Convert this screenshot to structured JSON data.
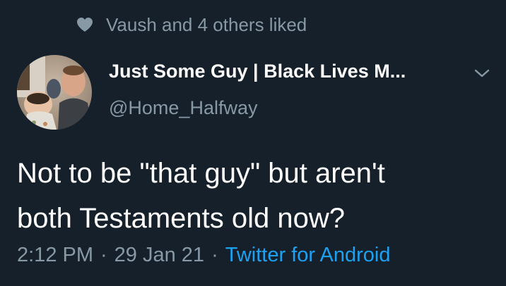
{
  "social_context": {
    "icon": "heart-icon",
    "text": "Vaush and 4 others liked"
  },
  "author": {
    "name": "Just Some Guy | Black Lives M...",
    "handle": "@Home_Halfway",
    "avatar": "profile-photo"
  },
  "tweet": {
    "line1": "Not to be \"that guy\" but aren't",
    "line2": "both Testaments old now?"
  },
  "meta": {
    "time": "2:12 PM",
    "separator": "·",
    "date": "29 Jan 21",
    "source": "Twitter for Android"
  },
  "colors": {
    "background": "#15202b",
    "text_primary": "#ffffff",
    "text_secondary": "#8899a6",
    "accent": "#1da1f2"
  }
}
